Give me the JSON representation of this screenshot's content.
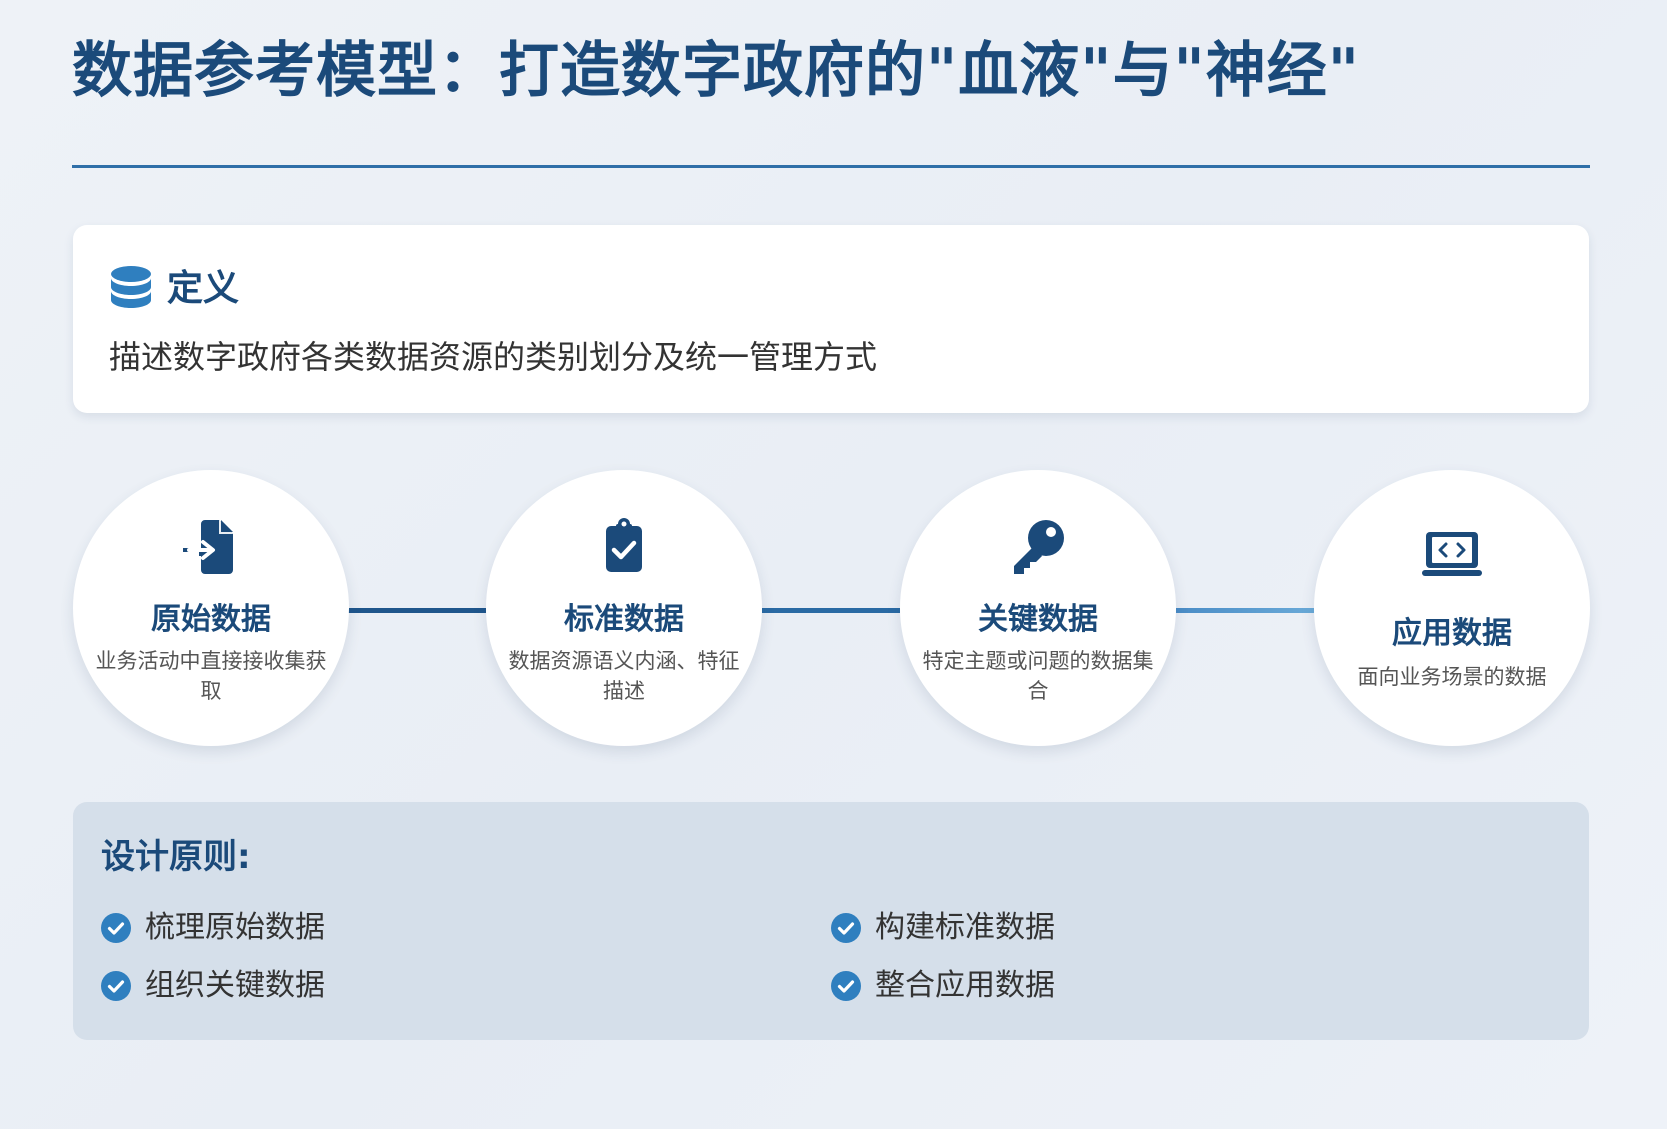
{
  "title": "数据参考模型：打造数字政府的\"血液\"与\"神经\"",
  "definition": {
    "icon": "database-icon",
    "heading": "定义",
    "text": "描述数字政府各类数据资源的类别划分及统一管理方式"
  },
  "flow": {
    "nodes": [
      {
        "icon": "file-import-icon",
        "title": "原始数据",
        "desc": "业务活动中直接接收集获取"
      },
      {
        "icon": "clipboard-check-icon",
        "title": "标准数据",
        "desc": "数据资源语义内涵、特征描述"
      },
      {
        "icon": "key-icon",
        "title": "关键数据",
        "desc": "特定主题或问题的数据集合"
      },
      {
        "icon": "laptop-code-icon",
        "title": "应用数据",
        "desc": "面向业务场景的数据"
      }
    ],
    "colors": {
      "primary": "#1b4a7a",
      "accent": "#2f6fa8",
      "light": "#5a9bd0"
    }
  },
  "principles": {
    "heading": "设计原则:",
    "icon": "check-circle-icon",
    "items": [
      "梳理原始数据",
      "构建标准数据",
      "组织关键数据",
      "整合应用数据"
    ]
  }
}
